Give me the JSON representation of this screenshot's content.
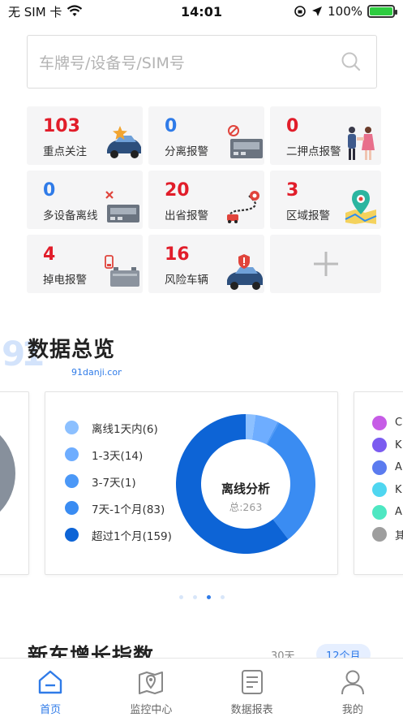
{
  "status_bar": {
    "carrier": "无 SIM 卡",
    "time": "14:01",
    "battery": "100%",
    "battery_level": 1.0
  },
  "search": {
    "placeholder": "车牌号/设备号/SIM号"
  },
  "alarm_cards": [
    {
      "count": "103",
      "label": "重点关注",
      "count_color": "#e11d2a",
      "icon": "car-star-icon"
    },
    {
      "count": "0",
      "label": "分离报警",
      "count_color": "#2f7be8",
      "icon": "device-detach-icon"
    },
    {
      "count": "0",
      "label": "二押点报警",
      "count_color": "#e11d2a",
      "icon": "people-handshake-icon"
    },
    {
      "count": "0",
      "label": "多设备离线",
      "count_color": "#2f7be8",
      "icon": "device-offline-icon"
    },
    {
      "count": "20",
      "label": "出省报警",
      "count_color": "#e11d2a",
      "icon": "route-pin-icon"
    },
    {
      "count": "3",
      "label": "区域报警",
      "count_color": "#e11d2a",
      "icon": "map-pin-icon"
    },
    {
      "count": "4",
      "label": "掉电报警",
      "count_color": "#e11d2a",
      "icon": "battery-low-icon"
    },
    {
      "count": "16",
      "label": "风险车辆",
      "count_color": "#e11d2a",
      "icon": "car-shield-icon"
    }
  ],
  "overview": {
    "title": "数据总览",
    "watermark": "91danji.com"
  },
  "offline_chart": {
    "title": "离线分析",
    "total_label": "总:263",
    "legend": [
      {
        "label": "离线1天内(6)",
        "color": "#8cc0ff"
      },
      {
        "label": "1-3天(14)",
        "color": "#6eadff"
      },
      {
        "label": "3-7天(1)",
        "color": "#4b98f7"
      },
      {
        "label": "7天-1个月(83)",
        "color": "#3a8cf2"
      },
      {
        "label": "超过1个月(159)",
        "color": "#0d64d6"
      }
    ]
  },
  "chart_data": {
    "type": "pie",
    "title": "离线分析",
    "categories": [
      "离线1天内",
      "1-3天",
      "3-7天",
      "7天-1个月",
      "超过1个月"
    ],
    "values": [
      6,
      14,
      1,
      83,
      159
    ],
    "total": 263,
    "colors": [
      "#8cc0ff",
      "#6eadff",
      "#4b98f7",
      "#3a8cf2",
      "#0d64d6"
    ]
  },
  "right_panel_legend": [
    {
      "label": "C",
      "color": "#c65ce6"
    },
    {
      "label": "K",
      "color": "#7b5cf0"
    },
    {
      "label": "A",
      "color": "#5b7bef"
    },
    {
      "label": "K",
      "color": "#4fd6f0"
    },
    {
      "label": "A",
      "color": "#4ee7c2"
    },
    {
      "label": "其",
      "color": "#9e9e9e"
    }
  ],
  "pager": {
    "count": 4,
    "active": 2
  },
  "growth": {
    "title": "新车增长指数",
    "tabs": [
      "30天",
      "12个月"
    ]
  },
  "bottom_nav": [
    {
      "label": "首页",
      "icon": "home-icon",
      "active": true
    },
    {
      "label": "监控中心",
      "icon": "map-icon",
      "active": false
    },
    {
      "label": "数据报表",
      "icon": "report-icon",
      "active": false
    },
    {
      "label": "我的",
      "icon": "user-icon",
      "active": false
    }
  ]
}
